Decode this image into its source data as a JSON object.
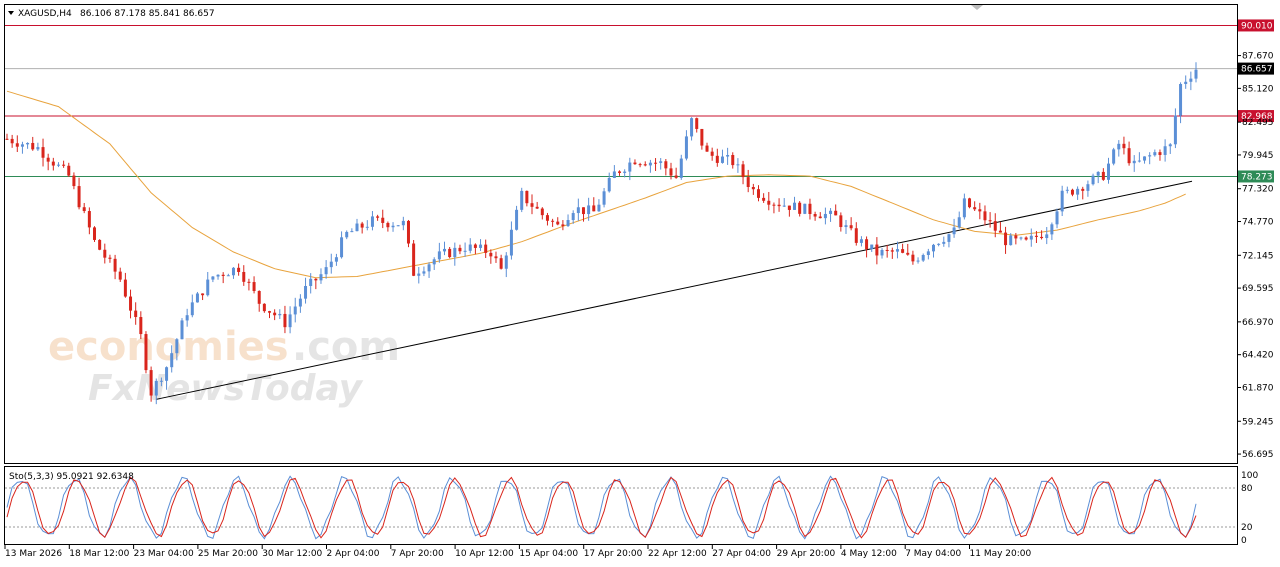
{
  "header": {
    "symbol": "XAGUSD,H4",
    "ohlc": "86.106 87.178 85.841 86.657",
    "dropdown_icon": "triangle-down-icon"
  },
  "watermark": {
    "line1_main": "economies",
    "line1_suffix": ".com",
    "line2": "FxNewsToday"
  },
  "stochastic": {
    "label": "Sto(5,3,3) 95.0921 92.6348",
    "levels": [
      "100",
      "80",
      "20",
      "0"
    ]
  },
  "colors": {
    "bull": "#5b8fd6",
    "bear": "#d9251c",
    "ma": "#e8a33d",
    "resistance": "#c8102e",
    "support": "#2e8b57",
    "trendline": "#000000",
    "stoch_main": "#5b8fd6",
    "stoch_signal": "#d9251c"
  },
  "chart_data": {
    "type": "candlestick",
    "price_axis_ticks": [
      "87.670",
      "85.120",
      "82.495",
      "79.945",
      "77.320",
      "74.770",
      "72.145",
      "69.595",
      "66.970",
      "64.420",
      "61.870",
      "59.245",
      "56.695"
    ],
    "price_range": [
      56.0,
      91.6
    ],
    "time_axis_labels": [
      "13 Mar 2026",
      "18 Mar 12:00",
      "23 Mar 04:00",
      "25 Mar 20:00",
      "30 Mar 12:00",
      "2 Apr 04:00",
      "7 Apr 20:00",
      "10 Apr 12:00",
      "15 Apr 04:00",
      "17 Apr 20:00",
      "22 Apr 12:00",
      "27 Apr 04:00",
      "29 Apr 20:00",
      "4 May 12:00",
      "7 May 04:00",
      "11 May 20:00"
    ],
    "horizontal_levels": [
      {
        "label": "90.010",
        "price": 90.01,
        "kind": "resistance"
      },
      {
        "label": "86.657",
        "price": 86.657,
        "kind": "current"
      },
      {
        "label": "82.968",
        "price": 82.968,
        "kind": "resistance"
      },
      {
        "label": "78.273",
        "price": 78.273,
        "kind": "support"
      }
    ],
    "trendline": {
      "from": {
        "time": "23 Mar 04:00",
        "price": 60.95
      },
      "to": {
        "time": "11 May 20:00",
        "price": 77.9
      }
    },
    "close_path": [
      [
        0,
        81.2
      ],
      [
        6,
        80.5
      ],
      [
        12,
        78.3
      ],
      [
        17,
        73.2
      ],
      [
        22,
        70.3
      ],
      [
        26,
        65.8
      ],
      [
        28,
        61.5
      ],
      [
        31,
        63.5
      ],
      [
        35,
        67.8
      ],
      [
        40,
        70.5
      ],
      [
        45,
        71.2
      ],
      [
        49,
        68.5
      ],
      [
        54,
        66.9
      ],
      [
        58,
        69.5
      ],
      [
        62,
        71.0
      ],
      [
        66,
        73.8
      ],
      [
        71,
        74.8
      ],
      [
        77,
        74.6
      ],
      [
        79,
        70.8
      ],
      [
        84,
        72.1
      ],
      [
        89,
        72.8
      ],
      [
        94,
        72.4
      ],
      [
        96,
        71.0
      ],
      [
        100,
        76.8
      ],
      [
        104,
        75.3
      ],
      [
        107,
        74.4
      ],
      [
        110,
        75.8
      ],
      [
        114,
        75.5
      ],
      [
        118,
        78.5
      ],
      [
        122,
        79.6
      ],
      [
        127,
        79.3
      ],
      [
        130,
        78.2
      ],
      [
        133,
        82.6
      ],
      [
        136,
        80.0
      ],
      [
        141,
        79.4
      ],
      [
        145,
        77.2
      ],
      [
        149,
        76.3
      ],
      [
        153,
        75.9
      ],
      [
        157,
        75.5
      ],
      [
        161,
        75.1
      ],
      [
        165,
        73.4
      ],
      [
        169,
        72.3
      ],
      [
        173,
        72.4
      ],
      [
        176,
        71.7
      ],
      [
        180,
        73.1
      ],
      [
        184,
        74.0
      ],
      [
        186,
        76.2
      ],
      [
        190,
        75.0
      ],
      [
        194,
        73.3
      ],
      [
        198,
        73.1
      ],
      [
        202,
        74.1
      ],
      [
        205,
        76.8
      ],
      [
        209,
        77.6
      ],
      [
        213,
        78.4
      ],
      [
        216,
        80.8
      ],
      [
        219,
        79.1
      ],
      [
        223,
        80.1
      ],
      [
        226,
        80.6
      ],
      [
        228,
        85.4
      ],
      [
        231,
        86.657
      ]
    ],
    "moving_average": [
      [
        0,
        84.9
      ],
      [
        10,
        83.7
      ],
      [
        20,
        80.8
      ],
      [
        28,
        77.0
      ],
      [
        36,
        74.3
      ],
      [
        44,
        72.4
      ],
      [
        52,
        71.1
      ],
      [
        60,
        70.4
      ],
      [
        68,
        70.5
      ],
      [
        76,
        71.1
      ],
      [
        84,
        71.7
      ],
      [
        92,
        72.3
      ],
      [
        100,
        73.2
      ],
      [
        108,
        74.4
      ],
      [
        116,
        75.5
      ],
      [
        124,
        76.6
      ],
      [
        132,
        77.8
      ],
      [
        140,
        78.3
      ],
      [
        148,
        78.4
      ],
      [
        156,
        78.3
      ],
      [
        164,
        77.5
      ],
      [
        172,
        76.2
      ],
      [
        180,
        74.9
      ],
      [
        188,
        74.0
      ],
      [
        196,
        73.7
      ],
      [
        204,
        74.1
      ],
      [
        212,
        74.9
      ],
      [
        220,
        75.6
      ],
      [
        225,
        76.2
      ],
      [
        229,
        76.9
      ]
    ],
    "stochastic_cycles": 22
  }
}
